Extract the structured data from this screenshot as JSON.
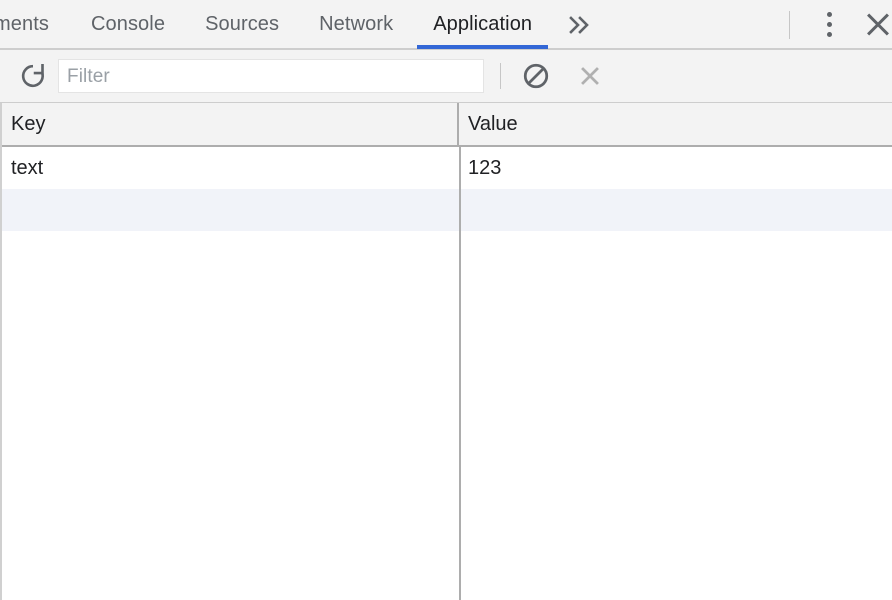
{
  "tabbar": {
    "tabs": [
      {
        "label": "ments",
        "active": false,
        "clipped": true,
        "name": "tab-elements"
      },
      {
        "label": "Console",
        "active": false,
        "clipped": false,
        "name": "tab-console"
      },
      {
        "label": "Sources",
        "active": false,
        "clipped": false,
        "name": "tab-sources"
      },
      {
        "label": "Network",
        "active": false,
        "clipped": false,
        "name": "tab-network"
      },
      {
        "label": "Application",
        "active": true,
        "clipped": false,
        "name": "tab-application"
      }
    ],
    "more_tabs_glyph": "»",
    "more_tabs_title": "More tabs",
    "menu_title": "Customize and control DevTools",
    "close_title": "Close DevTools"
  },
  "toolbar": {
    "refresh_title": "Refresh",
    "filter": {
      "value": "",
      "placeholder": "Filter"
    },
    "clear_all_title": "Clear all",
    "delete_selected_title": "Delete Selected"
  },
  "grid": {
    "columns": [
      {
        "label": "Key",
        "name": "column-header-key"
      },
      {
        "label": "Value",
        "name": "column-header-value"
      }
    ],
    "rows": [
      {
        "key": "text",
        "value": "123"
      },
      {
        "key": "",
        "value": ""
      }
    ]
  },
  "colors": {
    "accent_blue": "#3367d6",
    "toolbar_bg": "#f3f3f3",
    "row_stripe": "#f1f3f9",
    "text_primary": "#202124",
    "text_secondary": "#5f6368",
    "border": "#adadad"
  }
}
